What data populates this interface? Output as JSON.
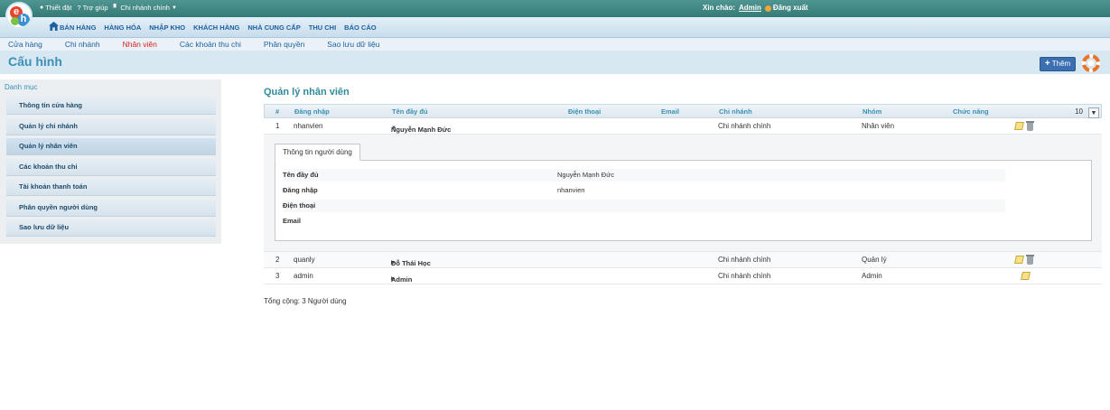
{
  "topbar": {
    "settings": "Thiết đặt",
    "help": "Trợ giúp",
    "branch": "Chi nhánh chính",
    "welcome": "Xin chào:",
    "user": "Admin",
    "logout": "Đăng xuất"
  },
  "main_menu": [
    "BÁN HÀNG",
    "HÀNG HÓA",
    "NHẬP KHO",
    "KHÁCH HÀNG",
    "NHÀ CUNG CẤP",
    "THU CHI",
    "BÁO CÁO"
  ],
  "sub_menu": [
    "Cửa hàng",
    "Chi nhánh",
    "Nhân viên",
    "Các khoản thu chi",
    "Phân quyền",
    "Sao lưu dữ liệu"
  ],
  "page_title": "Cấu hình",
  "add_button": "Thêm",
  "sidebar": {
    "heading": "Danh mục",
    "items": [
      "Thông tin cửa hàng",
      "Quản lý chi nhánh",
      "Quản lý nhân viên",
      "Các khoản thu chi",
      "Tài khoản thanh toán",
      "Phân quyền người dùng",
      "Sao lưu dữ liệu"
    ]
  },
  "section_title": "Quản lý nhân viên",
  "table": {
    "headers": {
      "num": "#",
      "login": "Đăng nhập",
      "fullname": "Tên đầy đủ",
      "phone": "Điện thoại",
      "email": "Email",
      "branch": "Chi nhánh",
      "group": "Nhóm",
      "function": "Chức năng"
    },
    "page_size": "10",
    "rows": [
      {
        "num": "1",
        "login": "nhanvien",
        "fullname": "Nguyễn Mạnh Đức",
        "branch": "Chi nhánh chính",
        "group": "Nhân viên"
      },
      {
        "num": "2",
        "login": "quanly",
        "fullname": "Đỗ Thái Học",
        "branch": "Chi nhánh chính",
        "group": "Quản lý"
      },
      {
        "num": "3",
        "login": "admin",
        "fullname": "Admin",
        "branch": "Chi nhánh chính",
        "group": "Admin"
      }
    ]
  },
  "detail": {
    "tab": "Thông tin người dùng",
    "fields": [
      {
        "label": "Tên đầy đủ",
        "value": "Nguyễn Mạnh Đức"
      },
      {
        "label": "Đăng nhập",
        "value": "nhanvien"
      },
      {
        "label": "Điện thoại",
        "value": ""
      },
      {
        "label": "Email",
        "value": ""
      }
    ]
  },
  "total": "Tổng cộng: 3 Người dùng",
  "colors": {
    "accent": "#3a8fb5",
    "active_submenu": "#d42020",
    "topbar": "#357a76"
  }
}
